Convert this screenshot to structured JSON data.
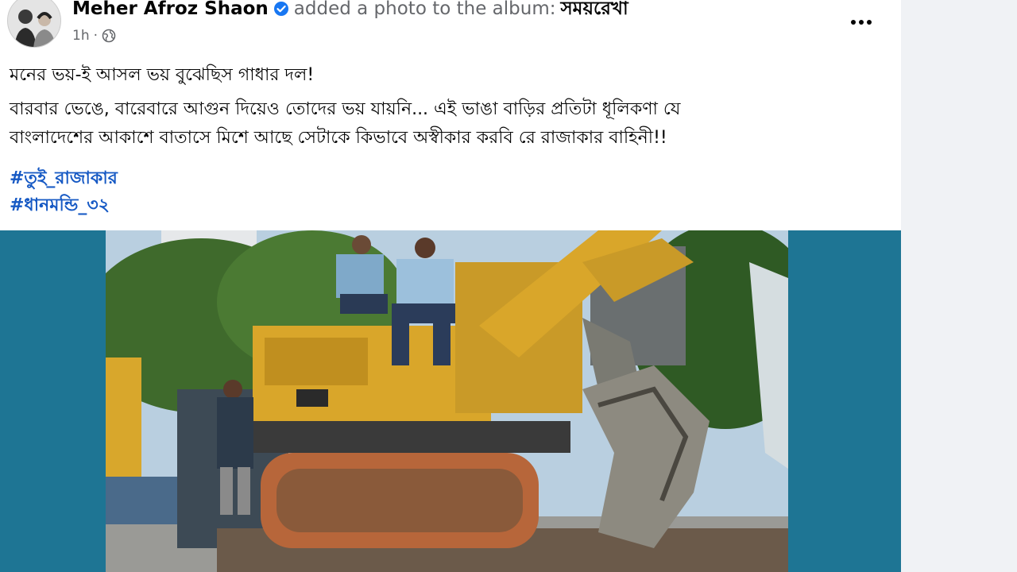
{
  "post": {
    "author": "Meher Afroz Shaon",
    "action": "added a photo to the album:",
    "album": "সময়রেখা",
    "time": "1h",
    "separator": "·",
    "audience_icon": "globe-icon",
    "more_icon": "more-options-icon",
    "verified_icon": "verified-badge-icon",
    "paragraph1": "মনের ভয়-ই আসল ভয় বুঝেছিস গাধার দল!",
    "paragraph2_line1": "বারবার ভেঙে, বারেবারে আগুন দিয়েও তোদের ভয় যায়নি... এই ভাঙা বাড়ির প্রতিটা ধূলিকণা যে",
    "paragraph2_line2": "বাংলাদেশের আকাশে বাতাসে মিশে আছে সেটাকে কিভাবে অস্বীকার করবি রে রাজাকার বাহিনী!!",
    "hashtags": [
      "#তুই_রাজাকার",
      "#ধানমন্ডি_৩২"
    ],
    "media_icon": "excavator-photo",
    "colors": {
      "name": "#050505",
      "secondary": "#65676b",
      "link": "#1659c4",
      "verified": "#1877f2",
      "media_background": "#1e7594",
      "page_background": "#f0f2f5"
    }
  }
}
